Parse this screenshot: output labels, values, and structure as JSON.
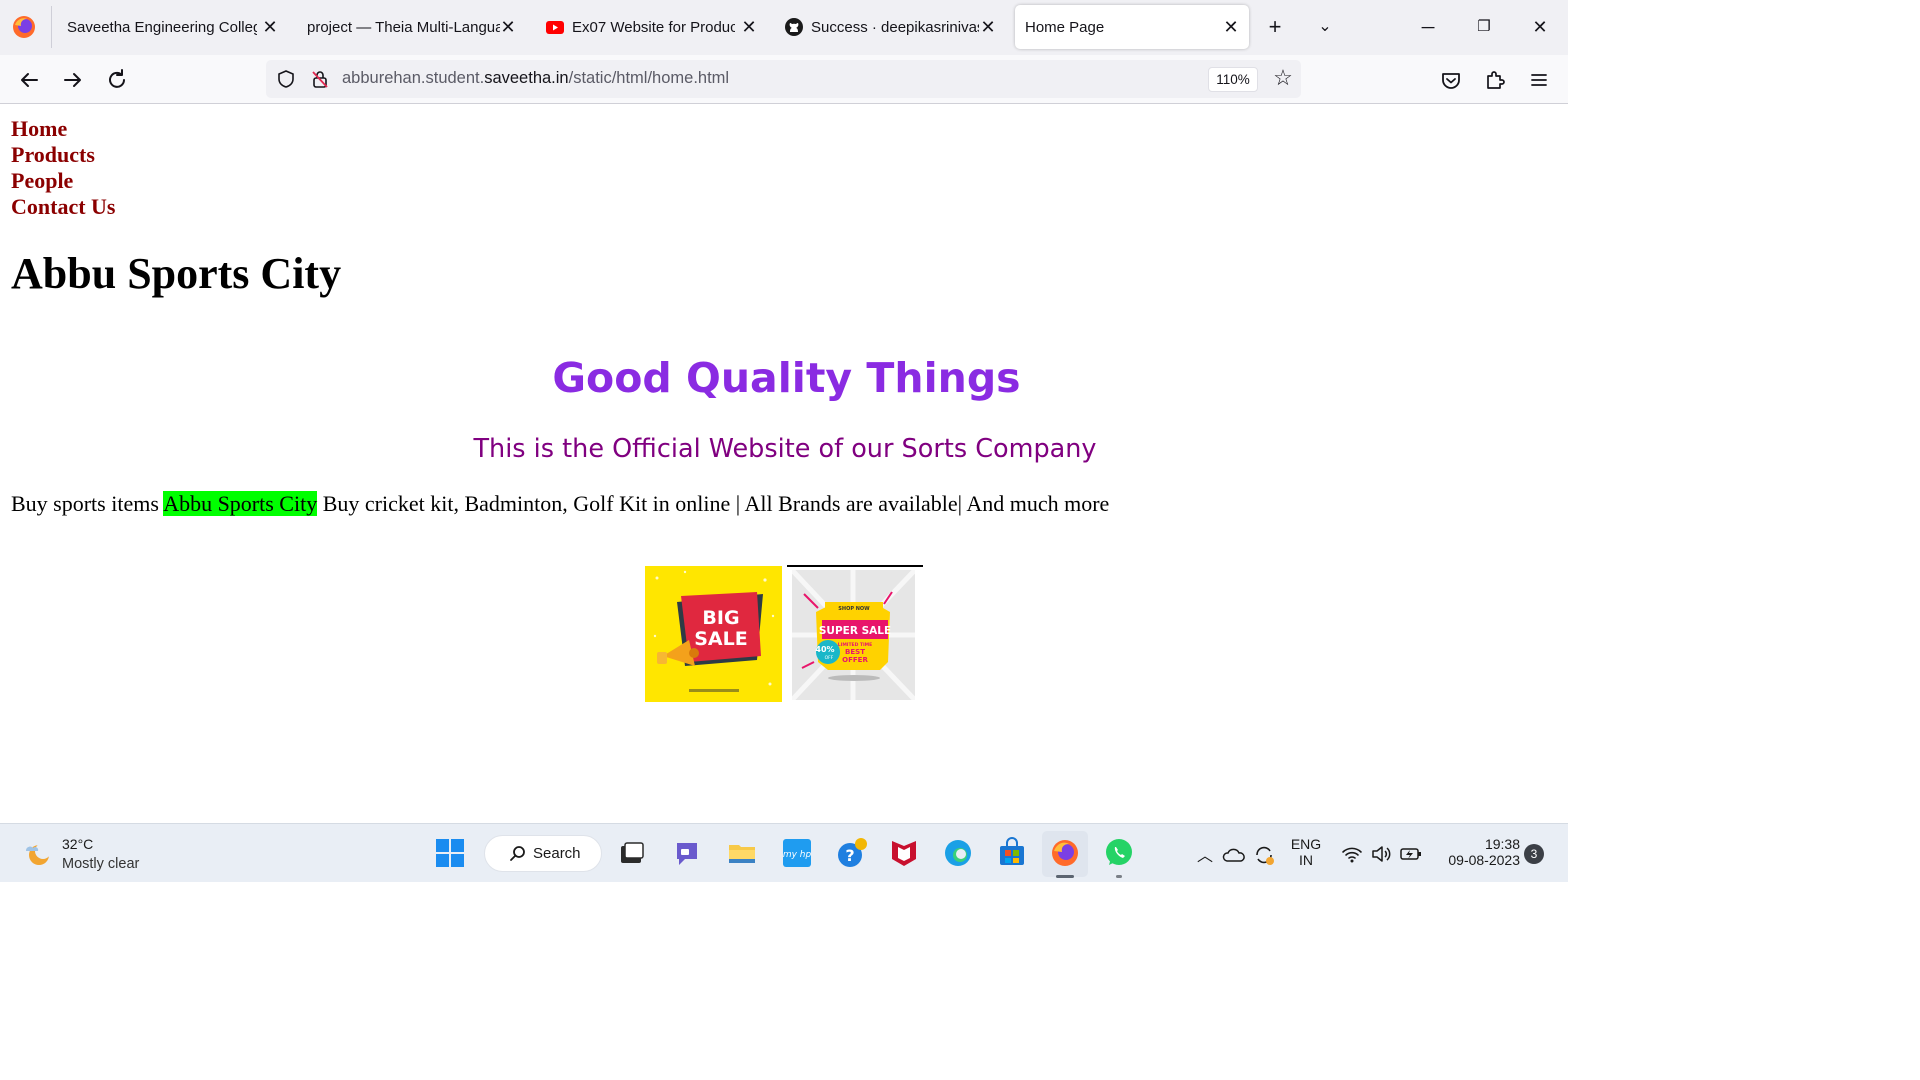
{
  "browser": {
    "tabs": [
      {
        "title": "Saveetha Engineering College",
        "favicon": "none"
      },
      {
        "title": "project — Theia Multi-Langua",
        "favicon": "none"
      },
      {
        "title": "Ex07 Website for Product",
        "favicon": "youtube-icon"
      },
      {
        "title": "Success · deepikasrinivasa",
        "favicon": "github-icon"
      },
      {
        "title": "Home Page",
        "favicon": "none",
        "active": true
      }
    ],
    "url": {
      "prefix": "abburehan.student.",
      "domain": "saveetha.in",
      "path": "/static/html/home.html"
    },
    "zoom": "110%"
  },
  "site": {
    "nav": [
      "Home",
      "Products",
      "People",
      "Contact Us"
    ],
    "title": "Abbu Sports City",
    "tagline": "Good Quality Things",
    "subtitle": "This is the Official Website of our Sorts Company",
    "promo": {
      "before": "Buy sports items ",
      "highlight": "Abbu Sports City",
      "after": " Buy cricket kit, Badminton, Golf Kit in online | All Brands are available| And much more"
    },
    "ads": {
      "big_sale": {
        "line1": "BIG",
        "line2": "SALE"
      },
      "super_sale": {
        "top": "SHOP NOW",
        "title": "SUPER SALE",
        "sub": "LIMITED TIME",
        "badge_num": "40%",
        "badge_off": "OFF",
        "offer1": "BEST",
        "offer2": "OFFER"
      }
    },
    "colors": {
      "nav_link": "#8b0000",
      "tagline": "#8a2be2",
      "subtitle": "#800080",
      "highlight": "#00ff00"
    }
  },
  "taskbar": {
    "weather": {
      "temp": "32°C",
      "desc": "Mostly clear"
    },
    "search_label": "Search",
    "tray": {
      "lang1": "ENG",
      "lang2": "IN",
      "time": "19:38",
      "date": "09-08-2023",
      "notifications": "3"
    }
  }
}
